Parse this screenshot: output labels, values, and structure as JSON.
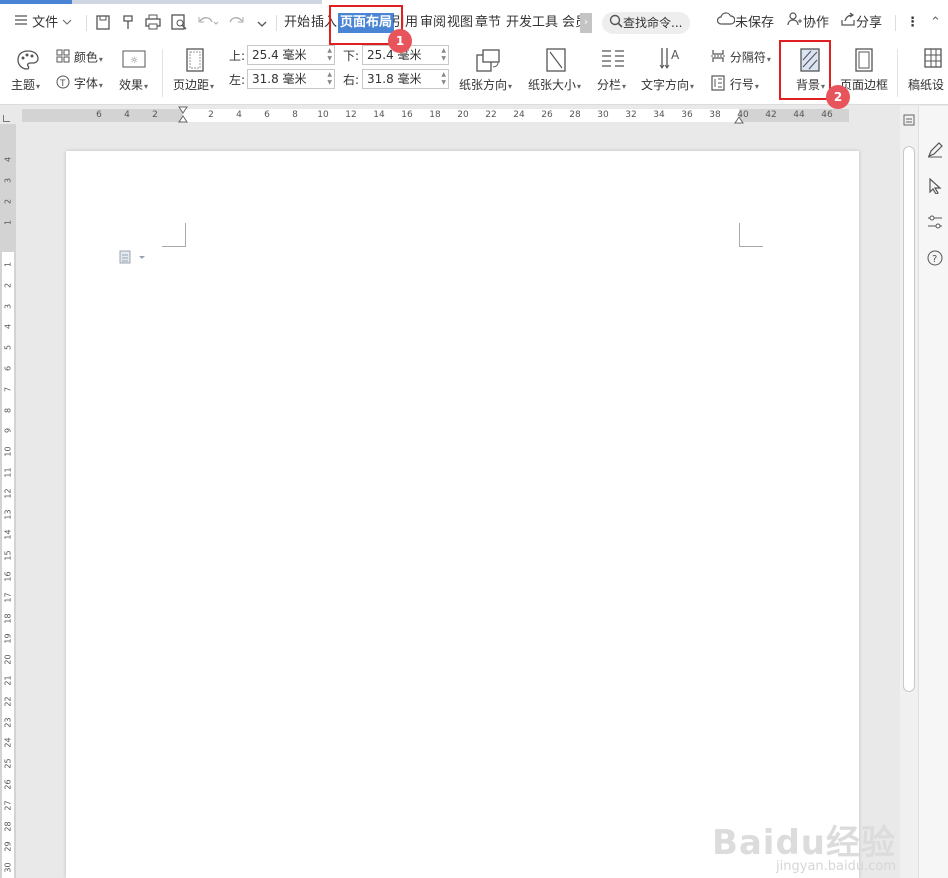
{
  "menu": {
    "file": "文件",
    "tabs": [
      "开始",
      "插入",
      "页面布局",
      "引用",
      "审阅",
      "视图",
      "章节",
      "开发工具",
      "会员"
    ],
    "search": "查找命令...",
    "unsaved": "未保存",
    "collaborate": "协作",
    "share": "分享"
  },
  "toolbar": {
    "theme": "主题",
    "color": "颜色",
    "font": "字体",
    "effect": "效果",
    "margins": "页边距",
    "top_label": "上:",
    "top_value": "25.4 毫米",
    "bottom_label": "下:",
    "bottom_value": "25.4 毫米",
    "left_label": "左:",
    "left_value": "31.8 毫米",
    "right_label": "右:",
    "right_value": "31.8 毫米",
    "orientation": "纸张方向",
    "size": "纸张大小",
    "columns": "分栏",
    "text_direction": "文字方向",
    "separator": "分隔符",
    "line_number": "行号",
    "background": "背景",
    "page_border": "页面边框",
    "draft_paper": "稿纸设"
  },
  "ruler": {
    "h_left": [
      "6",
      "4",
      "2"
    ],
    "h_right": [
      "2",
      "4",
      "6",
      "8",
      "10",
      "12",
      "14",
      "16",
      "18",
      "20",
      "22",
      "24",
      "26",
      "28",
      "30",
      "32",
      "34",
      "36",
      "38",
      "40",
      "42",
      "44",
      "46"
    ],
    "v_top": [
      "4",
      "3",
      "2",
      "1"
    ],
    "v_main": [
      "1",
      "2",
      "3",
      "4",
      "5",
      "6",
      "7",
      "8",
      "9",
      "10",
      "11",
      "12",
      "13",
      "14",
      "15",
      "16",
      "17",
      "18",
      "19",
      "20",
      "21",
      "22",
      "23",
      "24",
      "25",
      "26",
      "27",
      "28",
      "29",
      "30"
    ]
  },
  "annotations": {
    "step1": "1",
    "step2": "2"
  },
  "watermark": {
    "brand": "Baidu经验",
    "url": "jingyan.baidu.com"
  },
  "colors": {
    "accent": "#4a84d4",
    "highlight": "#e02020",
    "badge": "#e8545c"
  }
}
